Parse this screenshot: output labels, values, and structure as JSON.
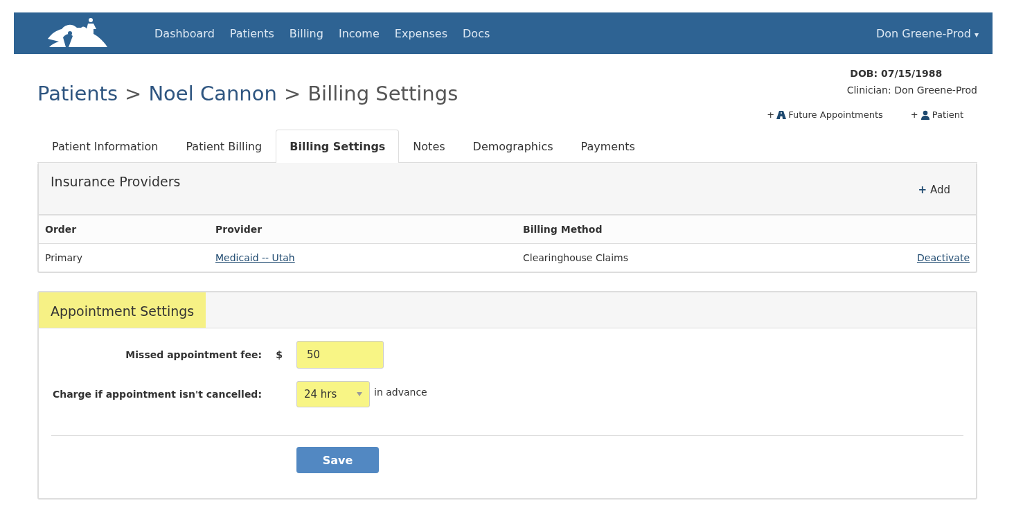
{
  "nav": {
    "items": [
      {
        "label": "Dashboard"
      },
      {
        "label": "Patients"
      },
      {
        "label": "Billing"
      },
      {
        "label": "Income"
      },
      {
        "label": "Expenses"
      },
      {
        "label": "Docs"
      }
    ],
    "user": "Don Greene-Prod",
    "user_caret": "▾"
  },
  "breadcrumb": [
    {
      "label": "Patients",
      "kind": "link"
    },
    {
      "label": ">",
      "kind": "separator"
    },
    {
      "label": "Noel Cannon",
      "kind": "link"
    },
    {
      "label": ">",
      "kind": "separator"
    },
    {
      "label": "Billing Settings",
      "kind": "current"
    }
  ],
  "patient": {
    "dob": "DOB: 07/15/1988",
    "clinician": "Clinician: Don Greene-Prod"
  },
  "actions": [
    {
      "plus": "+",
      "label": "Future Appointments",
      "kind": "road"
    },
    {
      "plus": "+",
      "label": "Patient",
      "kind": "person"
    }
  ],
  "tabs": [
    {
      "label": "Patient Information",
      "selected": false
    },
    {
      "label": "Patient Billing",
      "selected": false
    },
    {
      "label": "Billing Settings",
      "selected": true
    },
    {
      "label": "Notes",
      "selected": false
    },
    {
      "label": "Demographics",
      "selected": false
    },
    {
      "label": "Payments",
      "selected": false
    }
  ],
  "insurance": {
    "title": "Insurance Providers",
    "add_plus": "+",
    "add": "Add",
    "columns": [
      "Order",
      "Provider",
      "Billing Method"
    ],
    "rows": [
      {
        "order": "Primary",
        "provider": "Medicaid -- Utah",
        "method": "Clearinghouse Claims",
        "action": "Deactivate"
      }
    ]
  },
  "appointment": {
    "title": "Appointment Settings",
    "title_highlighted": true,
    "fee": {
      "label": "Missed appointment fee:",
      "prefix": "$",
      "value": "50",
      "highlighted": true
    },
    "charge": {
      "label": "Charge if appointment isn't cancelled:",
      "value": "24 hrs",
      "suffix": "in advance",
      "highlighted": true
    },
    "save": "Save"
  }
}
